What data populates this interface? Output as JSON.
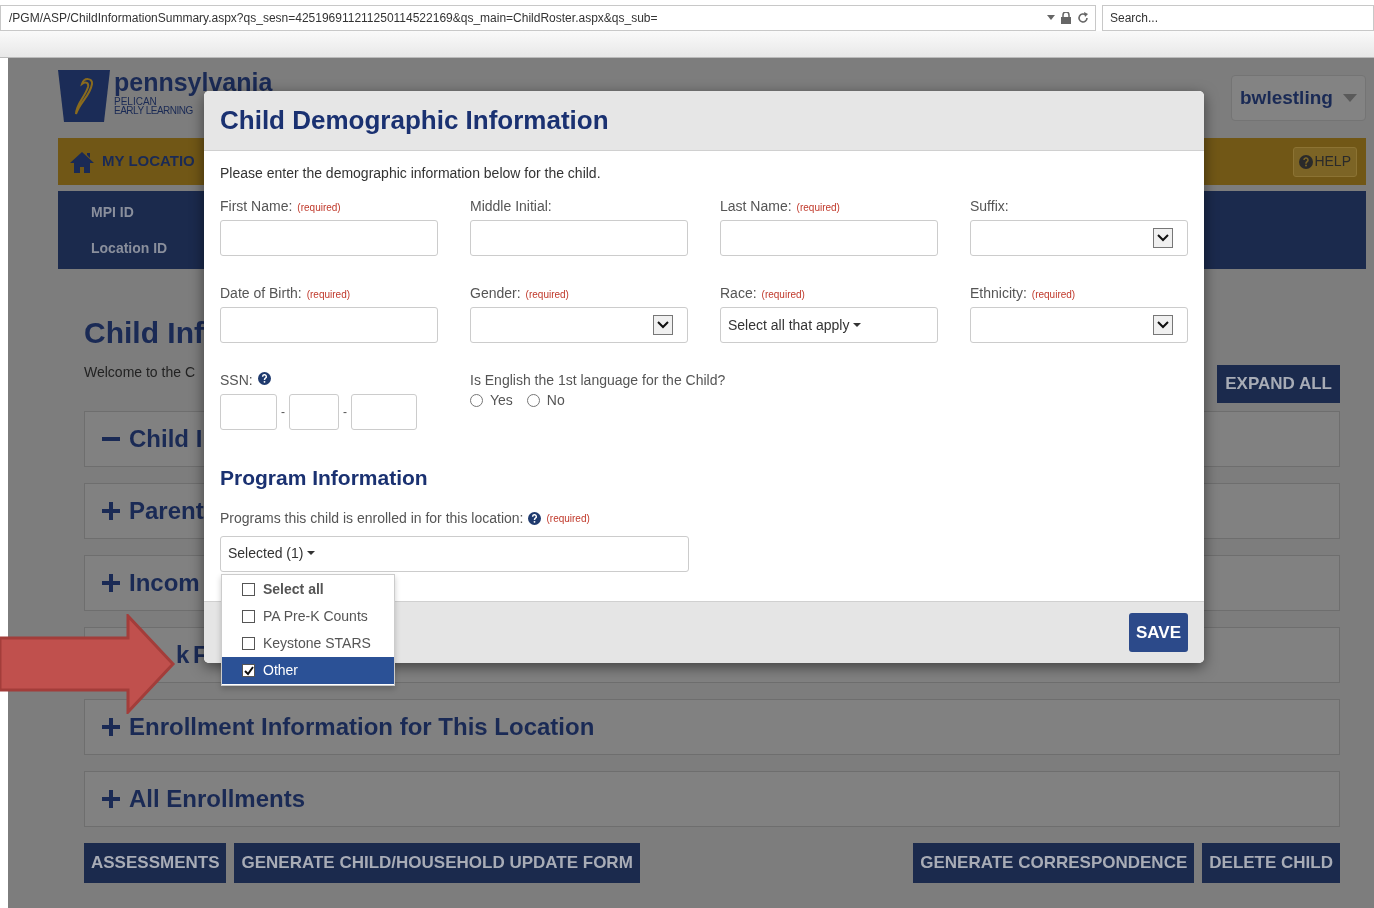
{
  "browser": {
    "url": "/PGM/ASP/ChildInformationSummary.aspx?qs_sesn=425196911211250114522169&qs_main=ChildRoster.aspx&qs_sub=",
    "search_placeholder": "Search..."
  },
  "header": {
    "logo_title": "pennsylvania",
    "logo_line_1": "PELICAN",
    "logo_line_2": "EARLY LEARNING",
    "user": "bwlestling"
  },
  "location_bar": {
    "label": "MY LOCATIO",
    "help": "HELP"
  },
  "id_panel": [
    "MPI ID",
    "Location ID"
  ],
  "page": {
    "title": "Child Inf",
    "welcome": "Welcome to the C",
    "expand_all": "EXPAND ALL"
  },
  "sections": [
    {
      "title": "Child I",
      "expanded": true
    },
    {
      "title": "Parent",
      "expanded": false
    },
    {
      "title": "Incom",
      "expanded": false
    },
    {
      "title": "k F"
    },
    {
      "title": "Enrollment Information for This Location",
      "expanded": false
    },
    {
      "title": "All Enrollments",
      "expanded": false
    }
  ],
  "actions": [
    "ASSESSMENTS",
    "GENERATE CHILD/HOUSEHOLD UPDATE FORM",
    "GENERATE CORRESPONDENCE",
    "DELETE CHILD"
  ],
  "modal": {
    "title": "Child Demographic Information",
    "intro": "Please enter the demographic information below for the child.",
    "fields": [
      {
        "kind": "text",
        "label": "First Name:",
        "required": "(required)"
      },
      {
        "kind": "text",
        "label": "Middle Initial:"
      },
      {
        "kind": "text",
        "label": "Last Name:",
        "required": "(required)"
      },
      {
        "kind": "select",
        "label": "Suffix:"
      },
      {
        "kind": "text",
        "label": "Date of Birth:",
        "required": "(required)"
      },
      {
        "kind": "select",
        "label": "Gender:",
        "required": "(required)"
      },
      {
        "kind": "multiselect",
        "label": "Race:",
        "required": "(required)",
        "value": "Select all that apply"
      },
      {
        "kind": "select",
        "label": "Ethnicity:",
        "required": "(required)"
      },
      {
        "kind": "ssn",
        "label": "SSN:",
        "separators": [
          "-",
          "-"
        ]
      },
      {
        "kind": "radio",
        "label": "Is English the 1st language for the Child?",
        "options": [
          {
            "label": "Yes",
            "selected": false
          },
          {
            "label": "No",
            "selected": false
          }
        ]
      }
    ],
    "program_heading": "Program Information",
    "programs": {
      "label": "Programs this child is enrolled in for this location:",
      "required": "(required)",
      "value": "Selected (1)",
      "options": [
        {
          "kind": "select_all",
          "label": "Select all",
          "checked": false,
          "selected": false
        },
        {
          "kind": "option",
          "label": "PA Pre-K Counts",
          "checked": false,
          "selected": false
        },
        {
          "kind": "option",
          "label": "Keystone STARS",
          "checked": false,
          "selected": false
        },
        {
          "kind": "option",
          "label": "Other",
          "checked": true,
          "selected": true
        }
      ]
    },
    "save": "SAVE"
  }
}
